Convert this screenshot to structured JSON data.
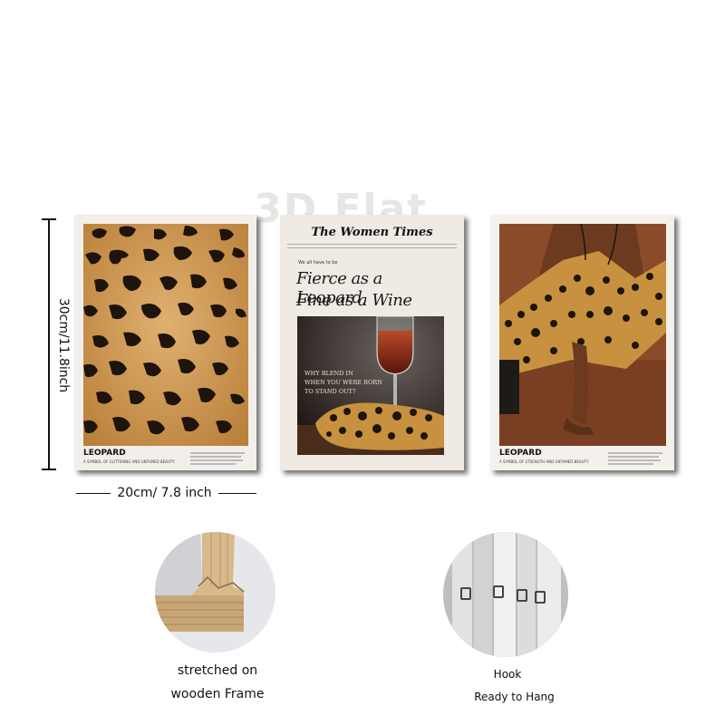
{
  "watermark": "3D Flat",
  "dimensions": {
    "height_label": "30cm/11.8inch",
    "width_label": "20cm/ 7.8 inch"
  },
  "poster1": {
    "title": "LEOPARD",
    "subtitle": "A SYMBOL OF GLITTERING AND UNTAMED BEAUTY"
  },
  "poster2": {
    "masthead": "The Women Times",
    "small_text": "We all have to be",
    "headline_line1": "Fierce as a Leopard,",
    "headline_line2": "Fine as a Wine",
    "photo_text_line1": "WHY BLEND IN",
    "photo_text_line2": "WHEN YOU WERE BORN",
    "photo_text_line3": "TO STAND OUT?"
  },
  "poster3": {
    "title": "LEOPARD",
    "subtitle": "A SYMBOL OF STRENGTH AND UNTAMED BEAUTY"
  },
  "features": {
    "frame_caption_line1": "stretched on",
    "frame_caption_line2": "wooden Frame",
    "hook_caption_line1": "Hook",
    "hook_caption_line2": "Ready to Hang"
  },
  "colors": {
    "leopard_base": "#c8913f",
    "spot": "#1e140c",
    "fashion_bg": "#8a4b2a",
    "skin": "#6b3a1f"
  }
}
